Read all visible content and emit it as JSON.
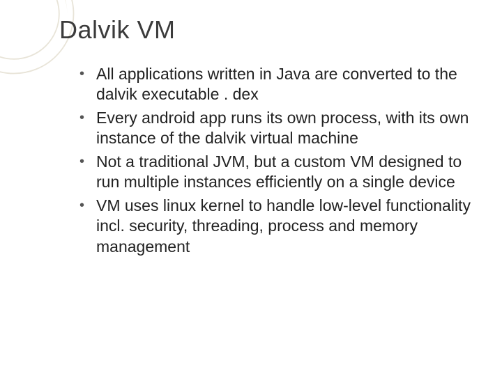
{
  "slide": {
    "title": "Dalvik VM",
    "bullets": [
      "All applications written in Java are converted to the dalvik executable . dex",
      "Every android app runs its own process, with its own instance of the dalvik virtual machine",
      "Not a traditional JVM, but a custom VM designed to run multiple instances efficiently on a single device",
      "VM uses linux kernel to handle low-level functionality incl. security, threading, process and memory management"
    ]
  }
}
